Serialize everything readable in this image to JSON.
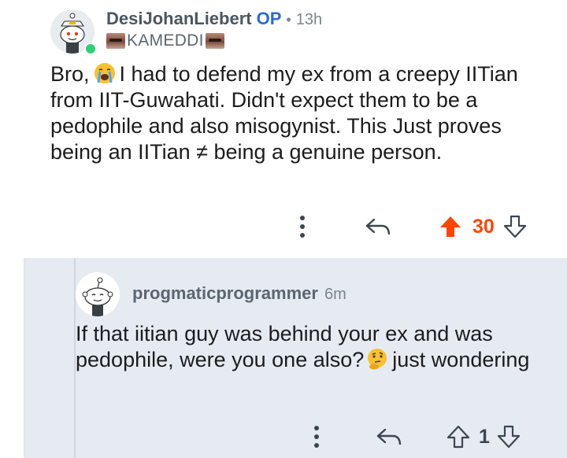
{
  "post": {
    "author": "DesiJohanLiebert",
    "op_badge": "OP",
    "separator": "•",
    "time": "13h",
    "flair": "KAMEDDI",
    "text_before_emoji": "Bro,",
    "emoji": "loudly-crying-face",
    "text_after_emoji": "I had to defend my ex from a creepy IITian from IIT-Guwahati. Didn't expect them to be a pedophile and also misogynist. This Just proves being an IITian ≠ being a genuine person.",
    "score": "30",
    "vote_state": "upvoted",
    "colors": {
      "upvote": "#ff4500",
      "op": "#2c6bd6",
      "online": "#2fd07a"
    }
  },
  "reply": {
    "author": "progmaticprogrammer",
    "time": "6m",
    "text_before_emoji": "If that iitian guy was behind your ex and was pedophile, were you one also?",
    "emoji": "thinking-face",
    "text_after_emoji": "just wondering",
    "score": "1",
    "vote_state": "none",
    "colors": {
      "background": "#e6ebf2"
    }
  }
}
